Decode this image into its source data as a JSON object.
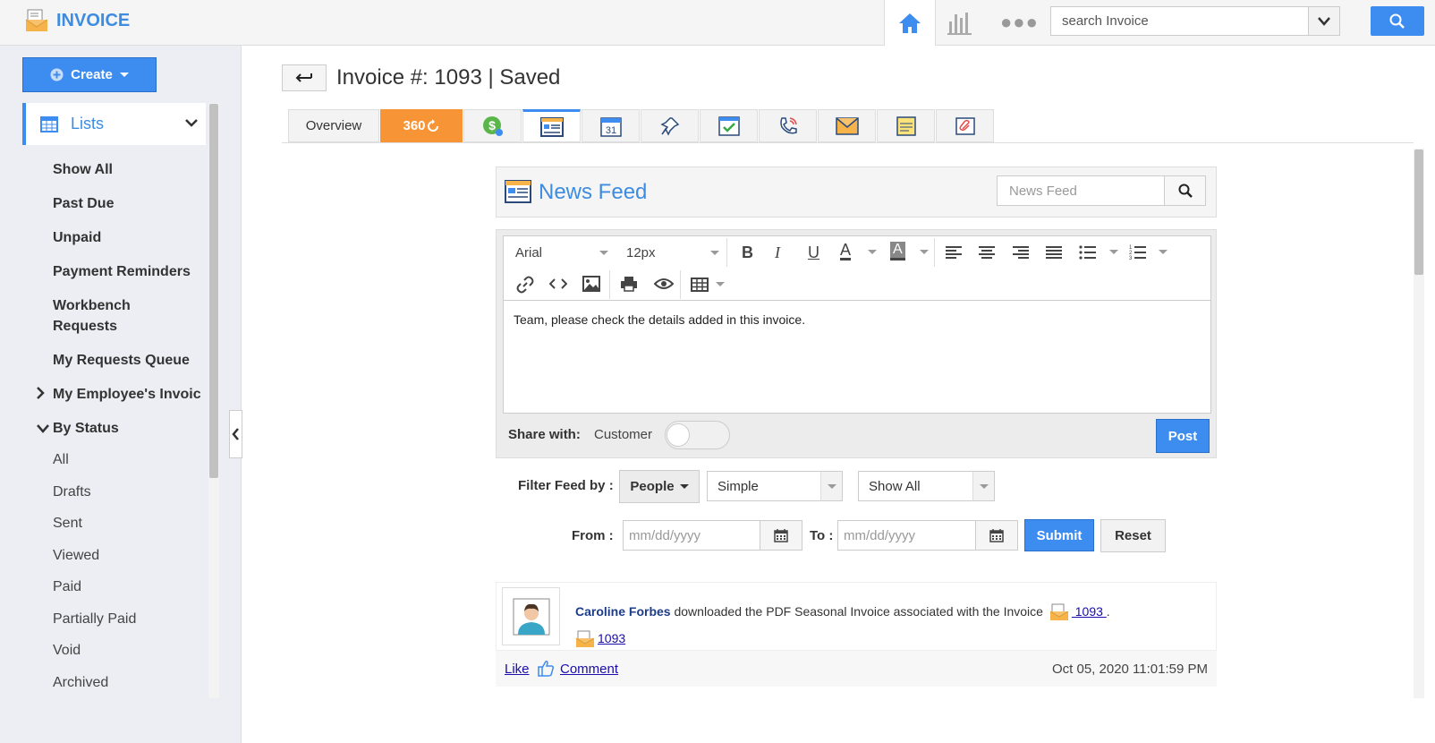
{
  "header": {
    "app_title": "INVOICE",
    "search_placeholder": "search Invoice"
  },
  "sidebar": {
    "create_label": "Create",
    "lists_label": "Lists",
    "items": [
      {
        "label": "Show All"
      },
      {
        "label": "Past Due"
      },
      {
        "label": "Unpaid"
      },
      {
        "label": "Payment Reminders"
      },
      {
        "label": "Workbench"
      },
      {
        "label": "Requests"
      },
      {
        "label": "My Requests Queue"
      },
      {
        "label": "My Employee's Invoic"
      },
      {
        "label": "By Status"
      }
    ],
    "status_items": [
      "All",
      "Drafts",
      "Sent",
      "Viewed",
      "Paid",
      "Partially Paid",
      "Void",
      "Archived"
    ]
  },
  "main": {
    "page_title": "Invoice #: 1093 | Saved",
    "tabs": {
      "overview": "Overview",
      "tab_360": "360"
    },
    "news_feed": {
      "title": "News Feed",
      "search_placeholder": "News Feed",
      "font_family": "Arial",
      "font_size": "12px",
      "editor_text": "Team, please check the details added in this invoice.",
      "share_label": "Share with:",
      "share_value": "Customer",
      "post_label": "Post"
    },
    "filters": {
      "label": "Filter Feed by :",
      "people": "People",
      "type_value": "Simple",
      "show_value": "Show All",
      "from_label": "From :",
      "to_label": "To :",
      "date_placeholder": "mm/dd/yyyy",
      "submit_label": "Submit",
      "reset_label": "Reset"
    },
    "feed": {
      "user": "Caroline Forbes",
      "action": " downloaded the PDF Seasonal Invoice associated with the Invoice ",
      "invoice_link_1": " 1093 ",
      "period": ".",
      "invoice_link_2": "1093",
      "like": "Like",
      "comment": "Comment",
      "timestamp": "Oct 05, 2020 11:01:59 PM"
    }
  },
  "colors": {
    "accent": "#3d8cf0",
    "tab_360": "#f79536",
    "sidebar_bg": "#eceef3"
  }
}
